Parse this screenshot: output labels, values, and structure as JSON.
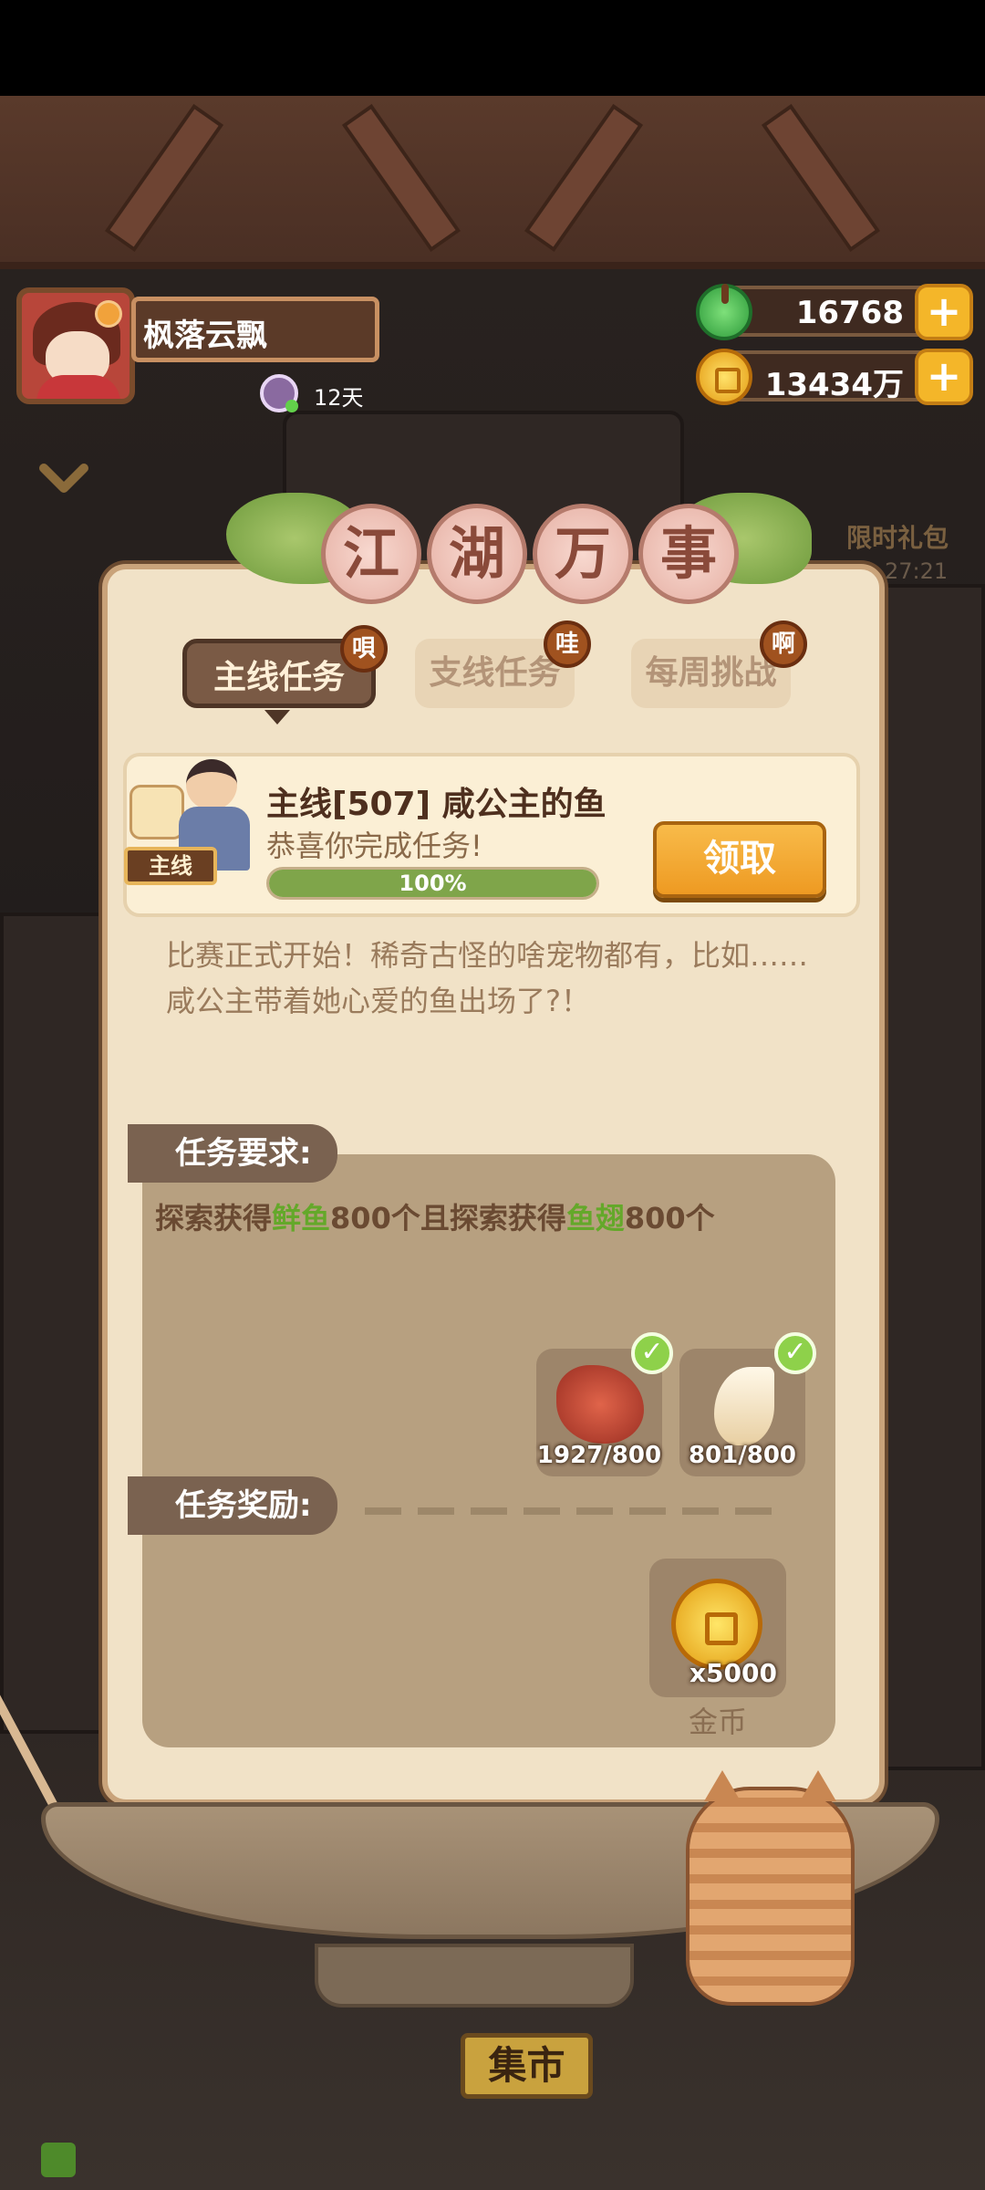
{
  "hud": {
    "player_name": "枫落云飘",
    "days": "12天",
    "jade_amount": "16768",
    "gold_amount": "13434万",
    "plus_label": "+",
    "gift_label": "限时礼包",
    "gift_timer": "27:21"
  },
  "panel": {
    "title_chars": [
      "江",
      "湖",
      "万",
      "事"
    ],
    "tabs": [
      {
        "label": "主线任务",
        "badge": "唄"
      },
      {
        "label": "支线任务",
        "badge": "哇"
      },
      {
        "label": "每周挑战",
        "badge": "啊"
      }
    ],
    "active_tab": 0,
    "quest": {
      "tag": "主线",
      "title": "主线[507] 咸公主的鱼",
      "subtitle": "恭喜你完成任务!",
      "progress_text": "100%",
      "progress_fraction": 1.0,
      "claim_label": "领取"
    },
    "description": "比赛正式开始！稀奇古怪的啥宠物都有，比如……咸公主带着她心爱的鱼出场了?！",
    "requirement": {
      "section_label": "任务要求:",
      "text_parts": [
        "探索获得",
        "鲜鱼",
        "800个且探索获得",
        "鱼翅",
        "800个"
      ],
      "items": [
        {
          "icon": "fresh-fish-icon",
          "count": "1927/800"
        },
        {
          "icon": "shark-fin-icon",
          "count": "801/800"
        }
      ]
    },
    "reward": {
      "section_label": "任务奖励:",
      "icon": "gold-coin-icon",
      "count": "x5000",
      "name": "金币"
    }
  },
  "bottom": {
    "market_label": "集市"
  },
  "colors": {
    "highlight_green": "#64a82a",
    "claim_orange": "#ee9a22",
    "panel_bg": "#f1e2c7"
  }
}
